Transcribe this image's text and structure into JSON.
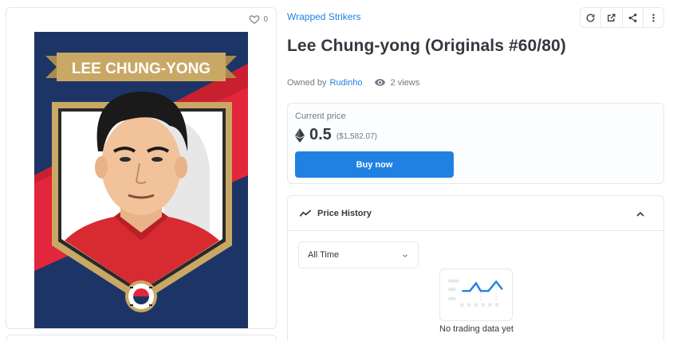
{
  "favorites": {
    "count": "0"
  },
  "artwork": {
    "banner_text": "LEE CHUNG-YONG",
    "colors": {
      "navy": "#1d3466",
      "red": "#e3263b",
      "gold": "#c9a865",
      "shirt": "#d72b31"
    }
  },
  "header": {
    "collection": "Wrapped Strikers",
    "title": "Lee Chung-yong (Originals #60/80)"
  },
  "toolbar": {
    "icons": [
      "refresh-icon",
      "external-link-icon",
      "share-icon",
      "more-icon"
    ]
  },
  "owner": {
    "prefix": "Owned by",
    "name": "Rudinho",
    "views": "2 views"
  },
  "price": {
    "label": "Current price",
    "value": "0.5",
    "usd": "($1,582.07)",
    "buy_label": "Buy now"
  },
  "price_history": {
    "title": "Price History",
    "filter": "All Time",
    "empty_text": "No trading data yet"
  },
  "colors": {
    "accent": "#2081e2",
    "text": "#353840",
    "muted": "#707a83",
    "border": "#e5e8eb"
  }
}
